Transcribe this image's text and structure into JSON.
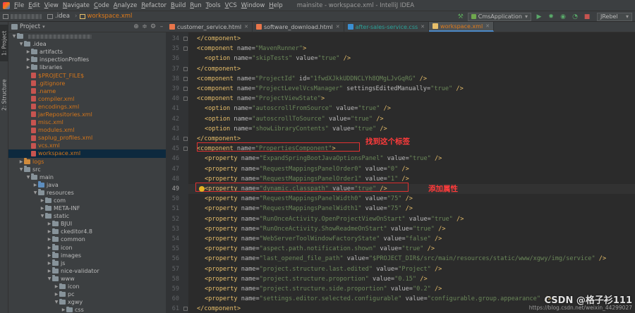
{
  "menubar": {
    "items": [
      "File",
      "Edit",
      "View",
      "Navigate",
      "Code",
      "Analyze",
      "Refactor",
      "Build",
      "Run",
      "Tools",
      "VCS",
      "Window",
      "Help"
    ],
    "window_title": "mainsite - workspace.xml - IntelliJ IDEA"
  },
  "navbar": {
    "crumbs": [
      ".idea",
      "workspace.xml"
    ],
    "run_config": "CmsApplication",
    "jrebel": "JRebel"
  },
  "sidebar": {
    "tabs": [
      "1: Project",
      "2: Structure"
    ]
  },
  "project_panel": {
    "title": "Project",
    "tree": [
      {
        "label": ".idea",
        "indent": 1,
        "type": "folder",
        "color": "grey",
        "open": true
      },
      {
        "label": "artifacts",
        "indent": 2,
        "type": "folder",
        "color": "grey",
        "open": false
      },
      {
        "label": "inspectionProfiles",
        "indent": 2,
        "type": "folder",
        "color": "grey",
        "open": false
      },
      {
        "label": "libraries",
        "indent": 2,
        "type": "folder",
        "color": "grey",
        "open": false
      },
      {
        "label": "$PROJECT_FILE$",
        "indent": 2,
        "type": "file",
        "color": "red"
      },
      {
        "label": ".gitignore",
        "indent": 2,
        "type": "file",
        "color": "red"
      },
      {
        "label": ".name",
        "indent": 2,
        "type": "file",
        "color": "red"
      },
      {
        "label": "compiler.xml",
        "indent": 2,
        "type": "file",
        "color": "red"
      },
      {
        "label": "encodings.xml",
        "indent": 2,
        "type": "file",
        "color": "red"
      },
      {
        "label": "jarRepositories.xml",
        "indent": 2,
        "type": "file",
        "color": "red"
      },
      {
        "label": "misc.xml",
        "indent": 2,
        "type": "file",
        "color": "red"
      },
      {
        "label": "modules.xml",
        "indent": 2,
        "type": "file",
        "color": "red"
      },
      {
        "label": "saplug_profiles.xml",
        "indent": 2,
        "type": "file",
        "color": "red"
      },
      {
        "label": "vcs.xml",
        "indent": 2,
        "type": "file",
        "color": "red"
      },
      {
        "label": "workspace.xml",
        "indent": 2,
        "type": "file",
        "color": "red",
        "selected": true
      },
      {
        "label": "logs",
        "indent": 1,
        "type": "folder",
        "color": "orange",
        "open": false
      },
      {
        "label": "src",
        "indent": 1,
        "type": "folder",
        "color": "grey",
        "open": true
      },
      {
        "label": "main",
        "indent": 2,
        "type": "folder",
        "color": "grey",
        "open": true
      },
      {
        "label": "java",
        "indent": 3,
        "type": "folder",
        "color": "blue",
        "open": false
      },
      {
        "label": "resources",
        "indent": 3,
        "type": "folder",
        "color": "grey",
        "open": true
      },
      {
        "label": "com",
        "indent": 4,
        "type": "folder",
        "color": "grey",
        "open": false
      },
      {
        "label": "META-INF",
        "indent": 4,
        "type": "folder",
        "color": "grey",
        "open": false
      },
      {
        "label": "static",
        "indent": 4,
        "type": "folder",
        "color": "grey",
        "open": true
      },
      {
        "label": "BJUI",
        "indent": 5,
        "type": "folder",
        "color": "grey",
        "open": false
      },
      {
        "label": "ckeditor4.8",
        "indent": 5,
        "type": "folder",
        "color": "grey",
        "open": false
      },
      {
        "label": "common",
        "indent": 5,
        "type": "folder",
        "color": "grey",
        "open": false
      },
      {
        "label": "icon",
        "indent": 5,
        "type": "folder",
        "color": "grey",
        "open": false
      },
      {
        "label": "images",
        "indent": 5,
        "type": "folder",
        "color": "grey",
        "open": false
      },
      {
        "label": "js",
        "indent": 5,
        "type": "folder",
        "color": "grey",
        "open": false
      },
      {
        "label": "nice-validator",
        "indent": 5,
        "type": "folder",
        "color": "grey",
        "open": false
      },
      {
        "label": "www",
        "indent": 5,
        "type": "folder",
        "color": "grey",
        "open": true
      },
      {
        "label": "icon",
        "indent": 6,
        "type": "folder",
        "color": "grey",
        "open": false
      },
      {
        "label": "pc",
        "indent": 6,
        "type": "folder",
        "color": "grey",
        "open": false
      },
      {
        "label": "xgwy",
        "indent": 6,
        "type": "folder",
        "color": "grey",
        "open": true
      },
      {
        "label": "css",
        "indent": 7,
        "type": "folder",
        "color": "grey",
        "open": false
      }
    ]
  },
  "editor_tabs": [
    {
      "label": "customer_service.html",
      "icon_color": "#e8754a",
      "active": false
    },
    {
      "label": "software_download.html",
      "icon_color": "#e8754a",
      "active": false
    },
    {
      "label": "after-sales-service.css",
      "icon_color": "#3b8fd1",
      "active": false,
      "teal": true
    },
    {
      "label": "workspace.xml",
      "icon_color": "#e8bf6a",
      "active": true
    }
  ],
  "code_lines": [
    {
      "n": "34",
      "indent": 1,
      "parts": [
        [
          "tg",
          "</component>"
        ]
      ]
    },
    {
      "n": "35",
      "indent": 1,
      "parts": [
        [
          "tg",
          "<component "
        ],
        [
          "an",
          "name="
        ],
        [
          "av",
          "\"MavenRunner\""
        ],
        [
          "tg",
          ">"
        ]
      ]
    },
    {
      "n": "36",
      "indent": 2,
      "parts": [
        [
          "tg",
          "<option "
        ],
        [
          "an",
          "name="
        ],
        [
          "av",
          "\"skipTests\""
        ],
        [
          "an",
          " value="
        ],
        [
          "av",
          "\"true\""
        ],
        [
          "tg",
          " />"
        ]
      ]
    },
    {
      "n": "37",
      "indent": 1,
      "parts": [
        [
          "tg",
          "</component>"
        ]
      ]
    },
    {
      "n": "38",
      "indent": 1,
      "parts": [
        [
          "tg",
          "<component "
        ],
        [
          "an",
          "name="
        ],
        [
          "av",
          "\"ProjectId\""
        ],
        [
          "an",
          " id="
        ],
        [
          "av",
          "\"1fwdXJkkUDDNCLYh8QMgLJvGqRG\""
        ],
        [
          "tg",
          " />"
        ]
      ]
    },
    {
      "n": "39",
      "indent": 1,
      "parts": [
        [
          "tg",
          "<component "
        ],
        [
          "an",
          "name="
        ],
        [
          "av",
          "\"ProjectLevelVcsManager\""
        ],
        [
          "an",
          " settingsEditedManually="
        ],
        [
          "av",
          "\"true\""
        ],
        [
          "tg",
          " />"
        ]
      ]
    },
    {
      "n": "40",
      "indent": 1,
      "parts": [
        [
          "tg",
          "<component "
        ],
        [
          "an",
          "name="
        ],
        [
          "av",
          "\"ProjectViewState\""
        ],
        [
          "tg",
          ">"
        ]
      ]
    },
    {
      "n": "41",
      "indent": 2,
      "parts": [
        [
          "tg",
          "<option "
        ],
        [
          "an",
          "name="
        ],
        [
          "av",
          "\"autoscrollFromSource\""
        ],
        [
          "an",
          " value="
        ],
        [
          "av",
          "\"true\""
        ],
        [
          "tg",
          " />"
        ]
      ]
    },
    {
      "n": "42",
      "indent": 2,
      "parts": [
        [
          "tg",
          "<option "
        ],
        [
          "an",
          "name="
        ],
        [
          "av",
          "\"autoscrollToSource\""
        ],
        [
          "an",
          " value="
        ],
        [
          "av",
          "\"true\""
        ],
        [
          "tg",
          " />"
        ]
      ]
    },
    {
      "n": "43",
      "indent": 2,
      "parts": [
        [
          "tg",
          "<option "
        ],
        [
          "an",
          "name="
        ],
        [
          "av",
          "\"showLibraryContents\""
        ],
        [
          "an",
          " value="
        ],
        [
          "av",
          "\"true\""
        ],
        [
          "tg",
          " />"
        ]
      ]
    },
    {
      "n": "44",
      "indent": 1,
      "parts": [
        [
          "tg",
          "</component>"
        ]
      ]
    },
    {
      "n": "45",
      "indent": 1,
      "parts": [
        [
          "tg",
          "<component "
        ],
        [
          "an",
          "name="
        ],
        [
          "av",
          "\"PropertiesComponent\""
        ],
        [
          "tg",
          ">"
        ]
      ]
    },
    {
      "n": "46",
      "indent": 2,
      "parts": [
        [
          "tg",
          "<property "
        ],
        [
          "an",
          "name="
        ],
        [
          "av",
          "\"ExpandSpringBootJavaOptionsPanel\""
        ],
        [
          "an",
          " value="
        ],
        [
          "av",
          "\"true\""
        ],
        [
          "tg",
          " />"
        ]
      ]
    },
    {
      "n": "47",
      "indent": 2,
      "parts": [
        [
          "tg",
          "<property "
        ],
        [
          "an",
          "name="
        ],
        [
          "av",
          "\"RequestMappingsPanelOrder0\""
        ],
        [
          "an",
          " value="
        ],
        [
          "av",
          "\"0\""
        ],
        [
          "tg",
          " />"
        ]
      ]
    },
    {
      "n": "48",
      "indent": 2,
      "parts": [
        [
          "tg",
          "<property "
        ],
        [
          "an",
          "name="
        ],
        [
          "av",
          "\"RequestMappingsPanelOrder1\""
        ],
        [
          "an",
          " value="
        ],
        [
          "av",
          "\"1\""
        ],
        [
          "tg",
          " />"
        ]
      ]
    },
    {
      "n": "49",
      "indent": 2,
      "current": true,
      "parts": [
        [
          "tg",
          "<property "
        ],
        [
          "an",
          "name="
        ],
        [
          "av",
          "\"dynamic.classpath\""
        ],
        [
          "an",
          " value="
        ],
        [
          "av",
          "\"true\""
        ],
        [
          "tg",
          " />"
        ]
      ]
    },
    {
      "n": "50",
      "indent": 2,
      "parts": [
        [
          "tg",
          "<property "
        ],
        [
          "an",
          "name="
        ],
        [
          "av",
          "\"RequestMappingsPanelWidth0\""
        ],
        [
          "an",
          " value="
        ],
        [
          "av",
          "\"75\""
        ],
        [
          "tg",
          " />"
        ]
      ]
    },
    {
      "n": "51",
      "indent": 2,
      "parts": [
        [
          "tg",
          "<property "
        ],
        [
          "an",
          "name="
        ],
        [
          "av",
          "\"RequestMappingsPanelWidth1\""
        ],
        [
          "an",
          " value="
        ],
        [
          "av",
          "\"75\""
        ],
        [
          "tg",
          " />"
        ]
      ]
    },
    {
      "n": "52",
      "indent": 2,
      "parts": [
        [
          "tg",
          "<property "
        ],
        [
          "an",
          "name="
        ],
        [
          "av",
          "\"RunOnceActivity.OpenProjectViewOnStart\""
        ],
        [
          "an",
          " value="
        ],
        [
          "av",
          "\"true\""
        ],
        [
          "tg",
          " />"
        ]
      ]
    },
    {
      "n": "53",
      "indent": 2,
      "parts": [
        [
          "tg",
          "<property "
        ],
        [
          "an",
          "name="
        ],
        [
          "av",
          "\"RunOnceActivity.ShowReadmeOnStart\""
        ],
        [
          "an",
          " value="
        ],
        [
          "av",
          "\"true\""
        ],
        [
          "tg",
          " />"
        ]
      ]
    },
    {
      "n": "54",
      "indent": 2,
      "parts": [
        [
          "tg",
          "<property "
        ],
        [
          "an",
          "name="
        ],
        [
          "av",
          "\"WebServerToolWindowFactoryState\""
        ],
        [
          "an",
          " value="
        ],
        [
          "av",
          "\"false\""
        ],
        [
          "tg",
          " />"
        ]
      ]
    },
    {
      "n": "55",
      "indent": 2,
      "parts": [
        [
          "tg",
          "<property "
        ],
        [
          "an",
          "name="
        ],
        [
          "av",
          "\"aspect.path.notification.shown\""
        ],
        [
          "an",
          " value="
        ],
        [
          "av",
          "\"true\""
        ],
        [
          "tg",
          " />"
        ]
      ]
    },
    {
      "n": "56",
      "indent": 2,
      "parts": [
        [
          "tg",
          "<property "
        ],
        [
          "an",
          "name="
        ],
        [
          "av",
          "\"last_opened_file_path\""
        ],
        [
          "an",
          " value="
        ],
        [
          "av",
          "\"$PROJECT_DIR$/src/main/resources/static/www/xgwy/img/service\""
        ],
        [
          "tg",
          " />"
        ]
      ]
    },
    {
      "n": "57",
      "indent": 2,
      "parts": [
        [
          "tg",
          "<property "
        ],
        [
          "an",
          "name="
        ],
        [
          "av",
          "\"project.structure.last.edited\""
        ],
        [
          "an",
          " value="
        ],
        [
          "av",
          "\"Project\""
        ],
        [
          "tg",
          " />"
        ]
      ]
    },
    {
      "n": "58",
      "indent": 2,
      "parts": [
        [
          "tg",
          "<property "
        ],
        [
          "an",
          "name="
        ],
        [
          "av",
          "\"project.structure.proportion\""
        ],
        [
          "an",
          " value="
        ],
        [
          "av",
          "\"0.15\""
        ],
        [
          "tg",
          " />"
        ]
      ]
    },
    {
      "n": "59",
      "indent": 2,
      "parts": [
        [
          "tg",
          "<property "
        ],
        [
          "an",
          "name="
        ],
        [
          "av",
          "\"project.structure.side.proportion\""
        ],
        [
          "an",
          " value="
        ],
        [
          "av",
          "\"0.2\""
        ],
        [
          "tg",
          " />"
        ]
      ]
    },
    {
      "n": "60",
      "indent": 2,
      "parts": [
        [
          "tg",
          "<property "
        ],
        [
          "an",
          "name="
        ],
        [
          "av",
          "\"settings.editor.selected.configurable\""
        ],
        [
          "an",
          " value="
        ],
        [
          "av",
          "\"configurable.group.appearance\""
        ],
        [
          "tg",
          " />"
        ]
      ]
    },
    {
      "n": "61",
      "indent": 1,
      "parts": [
        [
          "tg",
          "</component>"
        ]
      ]
    }
  ],
  "annotations": {
    "find_tag": "找到这个标签",
    "add_attr": "添加属性"
  },
  "watermark": {
    "main": "CSDN @格子衫111",
    "sub": "https://blog.csdn.net/weixin_44299027"
  }
}
